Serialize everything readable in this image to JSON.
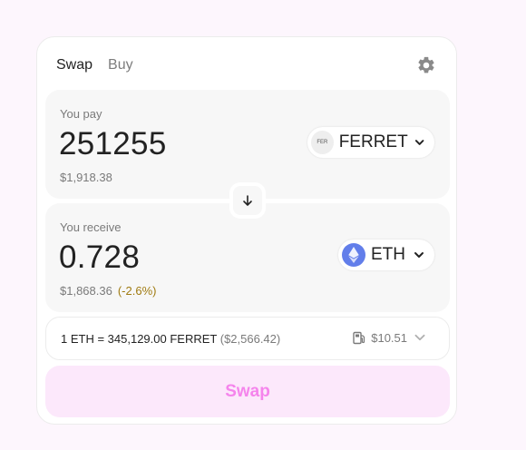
{
  "tabs": {
    "swap": "Swap",
    "buy": "Buy"
  },
  "pay": {
    "label": "You pay",
    "amount": "251255",
    "usd": "$1,918.38",
    "token": {
      "symbol": "FERRET",
      "icon_text": "FER"
    }
  },
  "receive": {
    "label": "You receive",
    "amount": "0.728",
    "usd": "$1,868.36",
    "delta": "(-2.6%)",
    "token": {
      "symbol": "ETH"
    }
  },
  "rate": {
    "text": "1 ETH = 345,129.00 FERRET",
    "usd": "($2,566.42)",
    "gas": "$10.51"
  },
  "swap_button": "Swap",
  "colors": {
    "accent_pink": "#f584ec",
    "swap_bg": "#fce8fb",
    "negative_delta": "#a07b12",
    "eth_blue": "#627eea"
  },
  "icons": [
    "gear-icon",
    "arrow-down-icon",
    "chevron-down-icon",
    "gas-pump-icon",
    "eth-logo-icon"
  ]
}
